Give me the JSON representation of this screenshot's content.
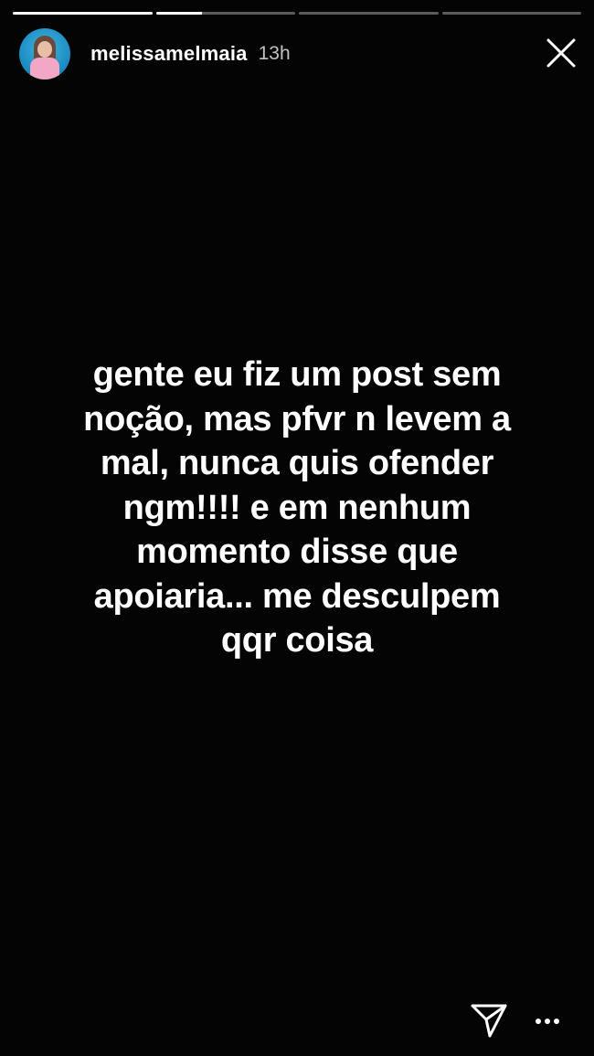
{
  "story": {
    "progress": [
      1,
      0.33,
      0,
      0
    ],
    "username": "melissamelmaia",
    "time": "13h",
    "text_lines": [
      "gente eu fiz um post sem",
      "noção, mas pfvr n levem a",
      "mal, nunca quis ofender",
      "ngm!!!! e em nenhum",
      "momento disse que",
      "apoiaria... me desculpem",
      "qqr coisa"
    ]
  },
  "icons": {
    "close": "close-icon",
    "send": "send-icon",
    "more": "more-options-icon"
  },
  "colors": {
    "background": "#040404",
    "text": "#ffffff"
  }
}
